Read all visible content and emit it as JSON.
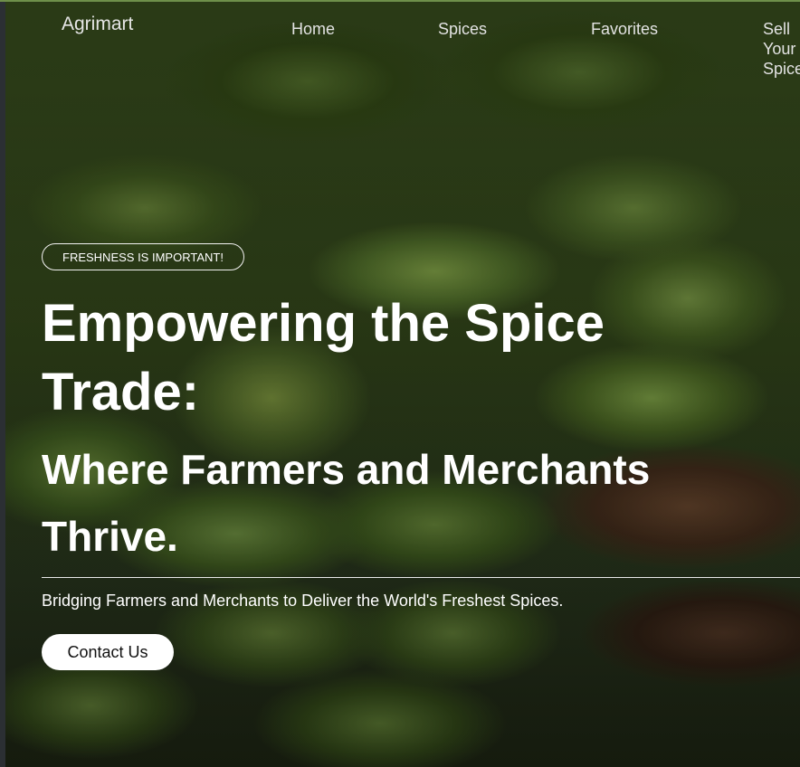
{
  "header": {
    "brand": "Agrimart",
    "nav": [
      {
        "label": "Home"
      },
      {
        "label": "Spices"
      },
      {
        "label": "Favorites"
      },
      {
        "label": "Sell Your Spices"
      }
    ]
  },
  "hero": {
    "tag": "FRESHNESS IS IMPORTANT!",
    "headline": "Empowering the Spice Trade:",
    "subheadline": "Where Farmers and Merchants Thrive.",
    "tagline": "Bridging Farmers and Merchants to Deliver the World's Freshest Spices.",
    "cta_label": "Contact Us"
  },
  "colors": {
    "text": "#ffffff",
    "button_bg": "#ffffff",
    "button_text": "#111111"
  }
}
